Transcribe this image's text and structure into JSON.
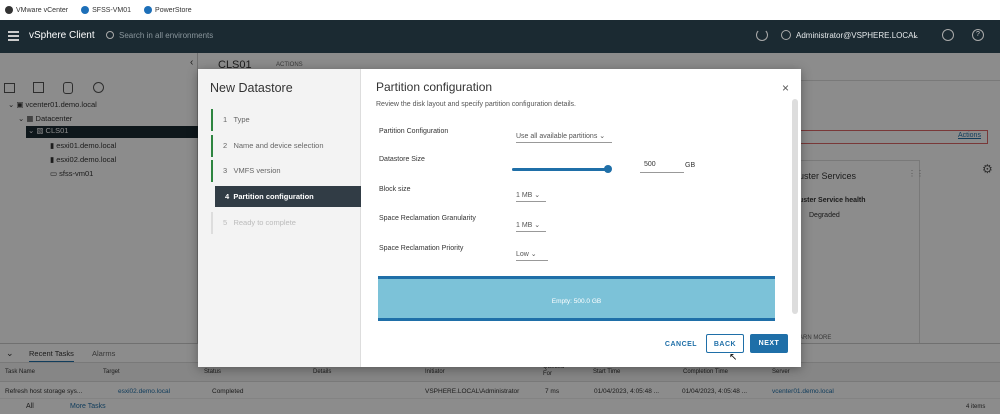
{
  "bookmarks": [
    {
      "label": "VMware vCenter"
    },
    {
      "label": "SFSS-VM01"
    },
    {
      "label": "PowerStore"
    }
  ],
  "header": {
    "app_title": "vSphere Client",
    "search_placeholder": "Search in all environments",
    "user": "Administrator@VSPHERE.LOCAL"
  },
  "tree": {
    "vcenter": "vcenter01.demo.local",
    "datacenter": "Datacenter",
    "cluster": "CLS01",
    "hosts": [
      "esxi01.demo.local",
      "esxi02.demo.local"
    ],
    "vm": "sfss-vm01"
  },
  "back": {
    "crumb_title": "CLS01",
    "actions_label": "ACTIONS",
    "actions_link": "Actions",
    "cluster_services_title": "uster Services",
    "cluster_service_health": "uster Service health",
    "degraded": "Degraded",
    "learn_more": "ARN MORE"
  },
  "dialog": {
    "wizard_title": "New Datastore",
    "steps": [
      {
        "num": "1",
        "label": "Type"
      },
      {
        "num": "2",
        "label": "Name and device selection"
      },
      {
        "num": "3",
        "label": "VMFS version"
      },
      {
        "num": "4",
        "label": "Partition configuration"
      },
      {
        "num": "5",
        "label": "Ready to complete"
      }
    ],
    "page_title": "Partition configuration",
    "description": "Review the disk layout and specify partition configuration details.",
    "fields": {
      "partition_config_label": "Partition Configuration",
      "partition_config_value": "Use all available partitions",
      "datastore_size_label": "Datastore Size",
      "datastore_size_value": "500",
      "datastore_size_unit": "GB",
      "slider_fraction": 1.0,
      "block_size_label": "Block size",
      "block_size_value": "1 MB",
      "granularity_label": "Space Reclamation Granularity",
      "granularity_value": "1 MB",
      "priority_label": "Space Reclamation Priority",
      "priority_value": "Low"
    },
    "disk_layout_text": "Empty: 500.0 GB",
    "buttons": {
      "cancel": "CANCEL",
      "back": "BACK",
      "next": "NEXT"
    }
  },
  "tasks": {
    "tabs": [
      "Recent Tasks",
      "Alarms"
    ],
    "columns": [
      "Task Name",
      "Target",
      "Status",
      "Details",
      "Initiator",
      "Queued For",
      "Start Time",
      "Completion Time",
      "Server"
    ],
    "row": {
      "task": "Refresh host storage sys...",
      "target": "esxi02.demo.local",
      "status": "Completed",
      "details": "",
      "initiator": "VSPHERE.LOCAL\\Administrator",
      "queued": "7 ms",
      "start": "01/04/2023, 4:05:48 ...",
      "completion": "01/04/2023, 4:05:48 ...",
      "server": "vcenter01.demo.local"
    },
    "filter": "All",
    "more": "More Tasks",
    "items": "4 items"
  },
  "colors": {
    "header_bg": "#1b2a32",
    "active_step": "#313c45",
    "primary": "#1f6fa8",
    "disk_bar": "#7cc2d8"
  }
}
